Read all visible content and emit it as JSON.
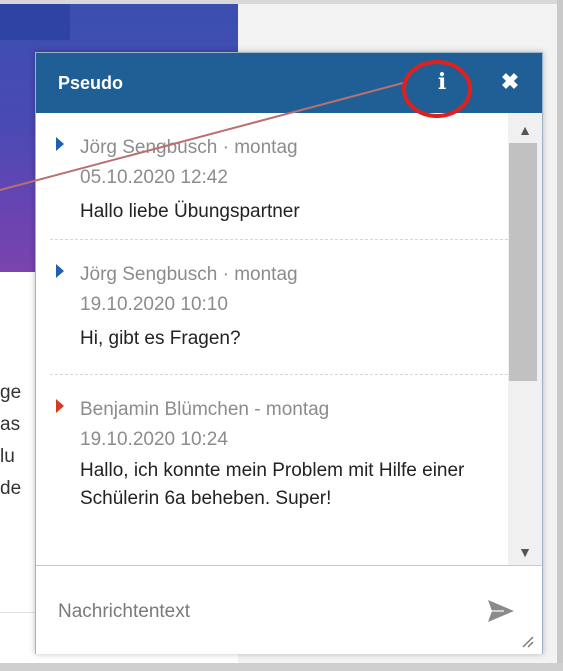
{
  "chat": {
    "title": "Pseudo",
    "info_icon": "info-icon",
    "close_icon": "close-icon",
    "messages": [
      {
        "author": "Jörg Sengbusch",
        "separator": "·",
        "day": "montag",
        "meta_line1": "Jörg Sengbusch · montag",
        "timestamp": "05.10.2020 12:42",
        "text": "Hallo liebe Übungspartner",
        "arrow_color": "#1f5fb6"
      },
      {
        "author": "Jörg Sengbusch",
        "separator": "·",
        "day": "montag",
        "meta_line1": "Jörg Sengbusch · montag",
        "timestamp": "19.10.2020 10:10",
        "text": "Hi, gibt es Fragen?",
        "arrow_color": "#1f5fb6"
      },
      {
        "author": "Benjamin Blümchen",
        "separator": "-",
        "day": "montag",
        "meta_line1": "Benjamin Blümchen - montag",
        "timestamp": "19.10.2020 10:24",
        "text": "Hallo, ich konnte mein Problem mit Hilfe einer Schülerin 6a beheben. Super!",
        "arrow_color": "#d63a1f"
      }
    ],
    "composer": {
      "placeholder": "Nachrichtentext",
      "send_icon": "send-icon",
      "resize_icon": "resize-handle-icon"
    }
  },
  "background_fragments": [
    "ge",
    "as",
    "lu",
    "de"
  ],
  "colors": {
    "header": "#1f5f96",
    "annotation": "#e0201c",
    "banner": "#4a4ab4"
  }
}
